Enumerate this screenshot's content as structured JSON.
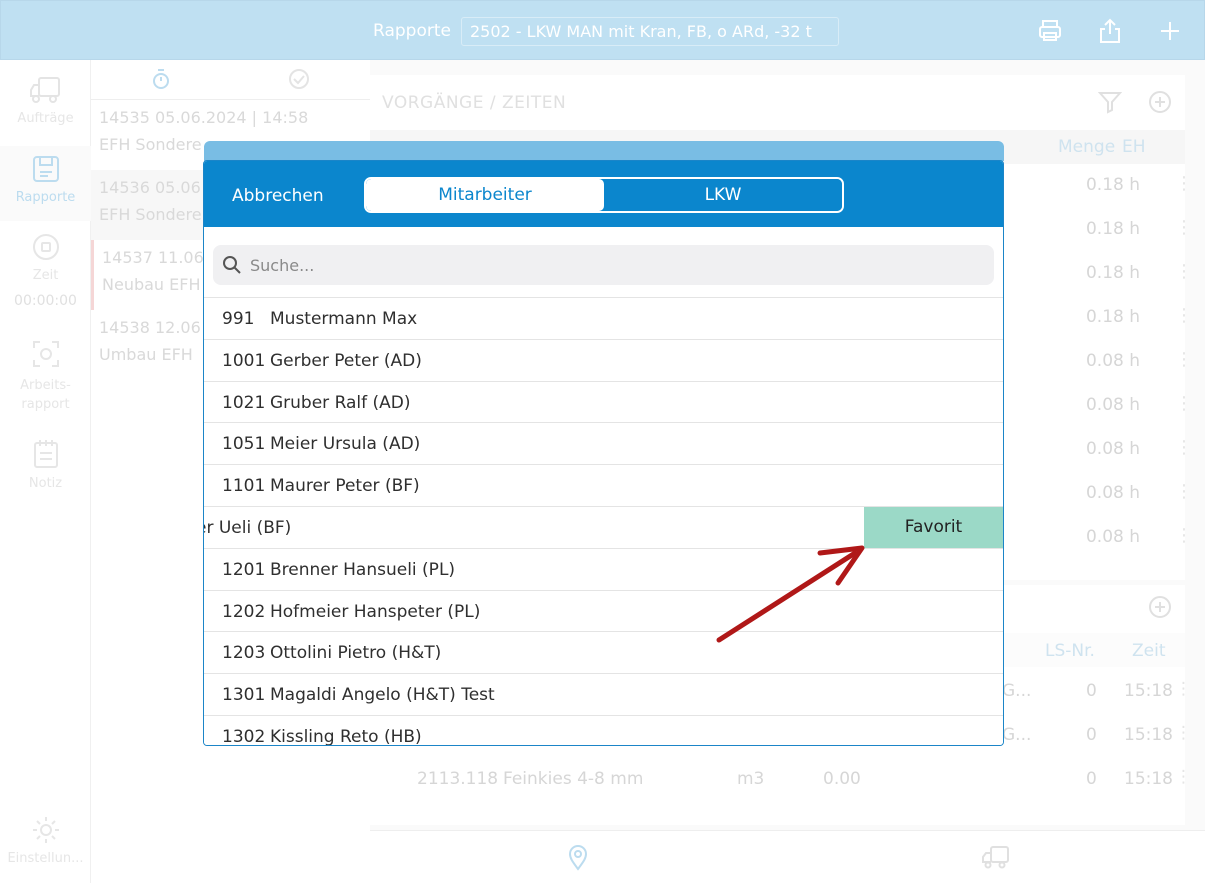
{
  "topbar": {
    "label": "Rapporte",
    "selected_vehicle": "2502 - LKW MAN mit Kran, FB, o ARd, -32 t",
    "icons": [
      "printer-icon",
      "share-icon",
      "plus-icon"
    ]
  },
  "sidebar": {
    "items": [
      {
        "label": "Aufträge",
        "icon": "truck-icon"
      },
      {
        "label": "Rapporte",
        "icon": "save-icon"
      },
      {
        "label": "Zeit",
        "sub": "00:00:00",
        "icon": "record-icon"
      },
      {
        "label": "Arbeits-\nrapport",
        "icon": "scan-icon"
      },
      {
        "label": "Notiz",
        "icon": "notepad-icon"
      }
    ],
    "settings_label": "Einstellun..."
  },
  "reports": [
    {
      "line1": "14535  05.06.2024 | 14:58",
      "line2": "EFH Sondere"
    },
    {
      "line1": "14536  05.06",
      "line2": "EFH Sondere"
    },
    {
      "line1": "14537  11.06.",
      "line2": "Neubau EFH"
    },
    {
      "line1": "14538  12.06",
      "line2": "Umbau EFH"
    }
  ],
  "main": {
    "section_title": "VORGÄNGE / ZEITEN",
    "header": {
      "col_menge": "Menge",
      "col_eh": "EH"
    },
    "rows": [
      "0.18 h",
      "0.18 h",
      "0.18 h",
      "0.18 h",
      "0.08 h",
      "0.08 h",
      "0.08 h",
      "0.08 h",
      "0.08 h"
    ],
    "material_header": {
      "ls_nr": "LS-Nr.",
      "zeit": "Zeit"
    },
    "material_rows": [
      {
        "trunc": "G...",
        "ls": "0",
        "time": "15:18"
      },
      {
        "trunc": "G...",
        "ls": "0",
        "time": "15:18"
      },
      {
        "nr": "2113.118",
        "desc": "Feinkies 4-8 mm",
        "unit": "m3",
        "qty": "0.00",
        "ls": "0",
        "time": "15:18"
      }
    ]
  },
  "modal": {
    "cancel_label": "Abbrechen",
    "tabs": [
      {
        "label": "Mitarbeiter",
        "active": true
      },
      {
        "label": "LKW",
        "active": false
      }
    ],
    "search_placeholder": "Suche...",
    "employees": [
      {
        "id": "991",
        "name": "Mustermann Max"
      },
      {
        "id": "1001",
        "name": "Gerber Peter (AD)"
      },
      {
        "id": "1021",
        "name": "Gruber Ralf (AD)"
      },
      {
        "id": "1051",
        "name": "Meier Ursula (AD)"
      },
      {
        "id": "1101",
        "name": "Maurer Peter (BF)"
      },
      {
        "id": "",
        "name": "er Ueli (BF)",
        "swiped": true
      },
      {
        "id": "1201",
        "name": "Brenner Hansueli (PL)"
      },
      {
        "id": "1202",
        "name": "Hofmeier Hanspeter (PL)"
      },
      {
        "id": "1203",
        "name": "Ottolini Pietro (H&T)"
      },
      {
        "id": "1301",
        "name": "Magaldi Angelo (H&T) Test"
      },
      {
        "id": "1302",
        "name": "Kissling Reto (HB)"
      }
    ],
    "favorite_label": "Favorit"
  },
  "colors": {
    "accent": "#0b86cd",
    "favorite": "#9bd9c7",
    "arrow": "#b01818"
  }
}
